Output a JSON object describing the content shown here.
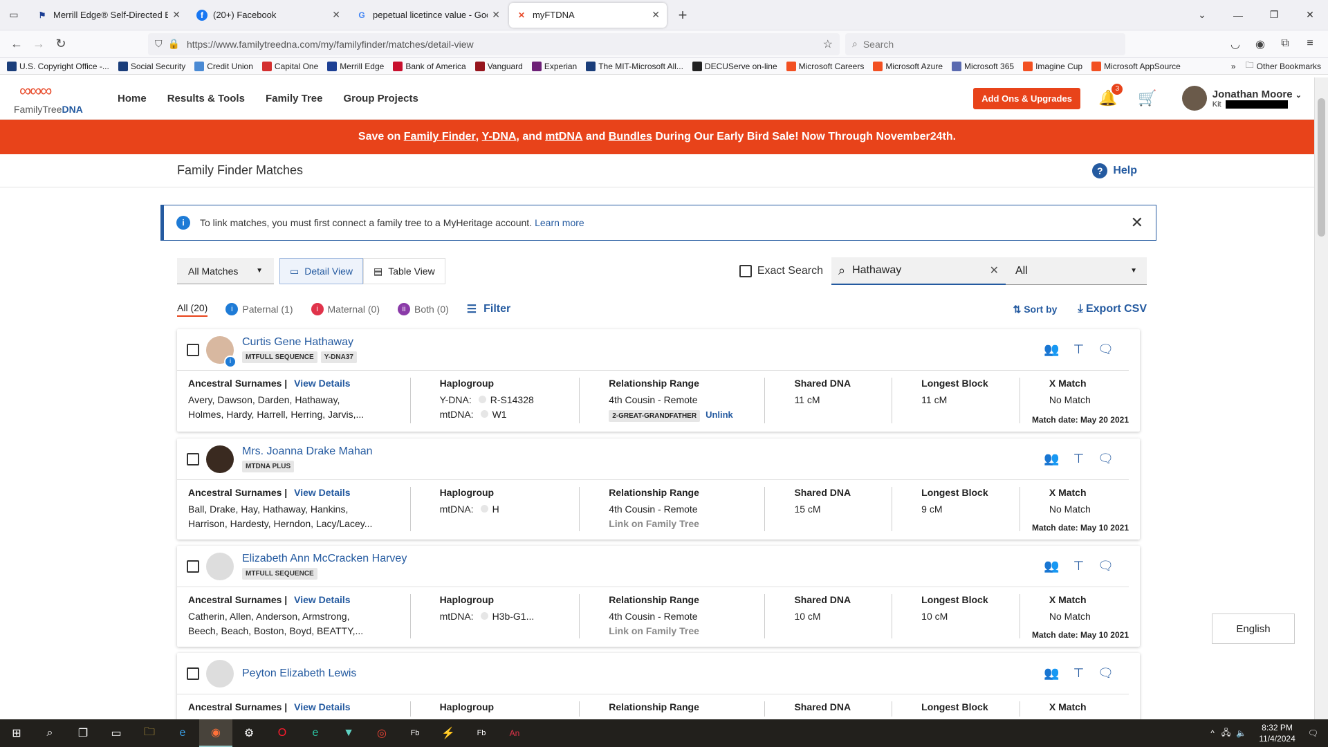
{
  "browser": {
    "tabs": [
      {
        "title": "Merrill Edge® Self-Directed Bu",
        "icon": "merrill-icon",
        "color": "#1c3f94"
      },
      {
        "title": "(20+) Facebook",
        "icon": "facebook-icon",
        "color": "#1877f2"
      },
      {
        "title": "pepetual licetince value - Goog",
        "icon": "google-icon",
        "color": "#4285f4"
      },
      {
        "title": "myFTDNA",
        "icon": "ftdna-icon",
        "color": "#e84c2c"
      }
    ],
    "url": "https://www.familytreedna.com/my/familyfinder/matches/detail-view",
    "search_placeholder": "Search",
    "bookmarks": [
      {
        "label": "U.S. Copyright Office -...",
        "color": "#1a3d7a"
      },
      {
        "label": "Social Security",
        "color": "#1a3d7a"
      },
      {
        "label": "Credit Union",
        "color": "#4a8ad4"
      },
      {
        "label": "Capital One",
        "color": "#d32f2f"
      },
      {
        "label": "Merrill Edge",
        "color": "#1c3f94"
      },
      {
        "label": "Bank of America",
        "color": "#c8102e"
      },
      {
        "label": "Vanguard",
        "color": "#96151d"
      },
      {
        "label": "Experian",
        "color": "#6d2077"
      },
      {
        "label": "The MIT-Microsoft All...",
        "color": "#1a3d7a"
      },
      {
        "label": "DECUServe on-line",
        "color": "#222222"
      },
      {
        "label": "Microsoft Careers",
        "color": "#f25022"
      },
      {
        "label": "Microsoft Azure",
        "color": "#f25022"
      },
      {
        "label": "Microsoft 365",
        "color": "#5a6ab0"
      },
      {
        "label": "Imagine Cup",
        "color": "#f25022"
      },
      {
        "label": "Microsoft AppSource",
        "color": "#f25022"
      }
    ],
    "other_bookmarks": "Other Bookmarks"
  },
  "site": {
    "logo_text_a": "FamilyTree",
    "logo_text_b": "DNA",
    "nav": [
      "Home",
      "Results & Tools",
      "Family Tree",
      "Group Projects"
    ],
    "addons_label": "Add Ons & Upgrades",
    "notification_count": "3",
    "user_name": "Jonathan Moore",
    "kit_label": "Kit",
    "promo": {
      "prefix": "Save on",
      "l1": "Family Finder",
      "sep1": ",",
      "l2": "Y-DNA",
      "sep2": ", and",
      "l3": "mtDNA",
      "sep3": "and",
      "l4": "Bundles",
      "suffix": "During Our Early Bird Sale! Now Through November24th."
    },
    "page_title": "Family Finder Matches",
    "help_label": "Help",
    "info_text": "To link matches, you must first connect a family tree to a MyHeritage account.",
    "info_link": "Learn more",
    "matches_dropdown": "All Matches",
    "detail_view": "Detail View",
    "table_view": "Table View",
    "exact_search": "Exact Search",
    "search_value": "Hathaway",
    "search_scope": "All",
    "filter_tabs": [
      {
        "label": "All (20)",
        "active": true
      },
      {
        "label": "Paternal (1)",
        "color": "#1e7bd6"
      },
      {
        "label": "Maternal (0)",
        "color": "#e0334a"
      },
      {
        "label": "Both (0)",
        "color": "#8a3aa8"
      }
    ],
    "filter_label": "Filter",
    "sort_label": "Sort by",
    "export_label": "Export CSV",
    "language": "English"
  },
  "labels": {
    "surnames": "Ancestral Surnames",
    "view_details": "View Details",
    "haplogroup": "Haplogroup",
    "relationship": "Relationship Range",
    "shared": "Shared DNA",
    "longest": "Longest Block",
    "xmatch": "X Match",
    "unlink": "Unlink",
    "link_ft": "Link on Family Tree"
  },
  "matches": [
    {
      "name": "Curtis Gene Hathaway",
      "tags": [
        "MTFULL SEQUENCE",
        "Y-DNA37"
      ],
      "surnames_1": "Avery, Dawson, Darden, Hathaway,",
      "surnames_2": "Holmes, Hardy, Harrell, Herring, Jarvis,...",
      "ydna_label": "Y-DNA:",
      "ydna": "R-S14328",
      "mtdna_label": "mtDNA:",
      "mtdna": "W1",
      "relationship": "4th Cousin - Remote",
      "rel_tag": "2-GREAT-GRANDFATHER",
      "shared": "11 cM",
      "longest": "11 cM",
      "xmatch": "No Match",
      "match_date": "Match date: May 20 2021"
    },
    {
      "name": "Mrs. Joanna Drake Mahan",
      "tags": [
        "MTDNA PLUS"
      ],
      "surnames_1": "Ball, Drake, Hay, Hathaway, Hankins,",
      "surnames_2": "Harrison, Hardesty, Herndon, Lacy/Lacey...",
      "mtdna_label": "mtDNA:",
      "mtdna": "H",
      "relationship": "4th Cousin - Remote",
      "shared": "15 cM",
      "longest": "9 cM",
      "xmatch": "No Match",
      "match_date": "Match date: May 10 2021"
    },
    {
      "name": "Elizabeth Ann McCracken Harvey",
      "tags": [
        "MTFULL SEQUENCE"
      ],
      "surnames_1": "Catherin, Allen, Anderson, Armstrong,",
      "surnames_2": "Beech, Beach, Boston, Boyd, BEATTY,...",
      "mtdna_label": "mtDNA:",
      "mtdna": "H3b-G1...",
      "relationship": "4th Cousin - Remote",
      "shared": "10 cM",
      "longest": "10 cM",
      "xmatch": "No Match",
      "match_date": "Match date: May 10 2021"
    },
    {
      "name": "Peyton Elizabeth Lewis",
      "tags": []
    }
  ],
  "taskbar": {
    "time": "8:32 PM",
    "date": "11/4/2024"
  }
}
